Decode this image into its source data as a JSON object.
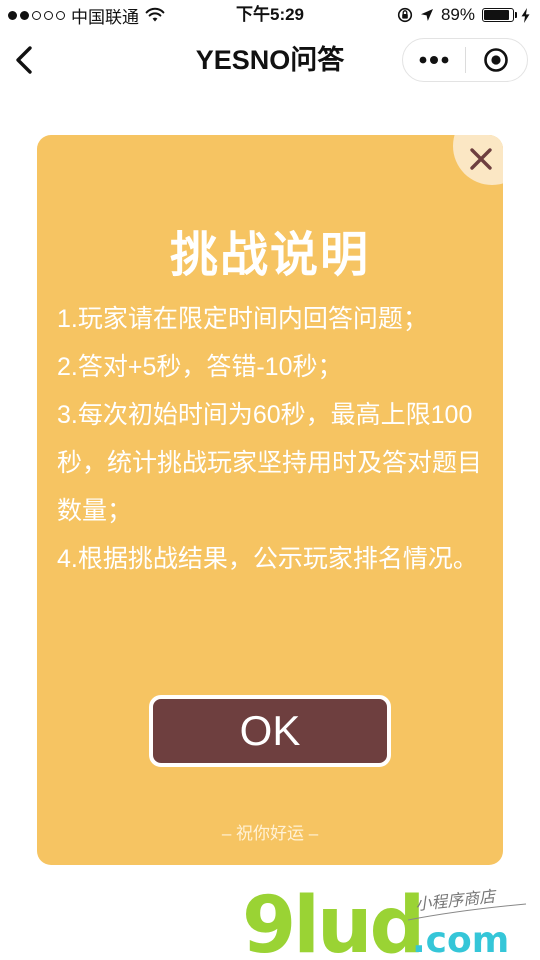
{
  "status_bar": {
    "carrier": "中国联通",
    "time": "下午5:29",
    "battery_percent": "89%",
    "battery_level": 0.89,
    "signal_bars_filled": 2,
    "signal_bars_total": 5,
    "icons": [
      "signal-dots-icon",
      "wifi-icon",
      "orientation-lock-icon",
      "location-arrow-icon",
      "battery-icon",
      "charging-bolt-icon"
    ]
  },
  "nav": {
    "title": "YESNO问答",
    "back_icon": "chevron-left-icon",
    "more_icon": "more-dots-icon",
    "close_icon": "target-circle-icon"
  },
  "modal": {
    "title": "挑战说明",
    "rules": [
      "1.玩家请在限定时间内回答问题；",
      "2.答对+5秒，答错-10秒；",
      "3.每次初始时间为60秒，最高上限100秒，统计挑战玩家坚持用时及答对题目数量；",
      "4.根据挑战结果，公示玩家排名情况。"
    ],
    "ok_label": "OK",
    "footer_text": "– 祝你好运 –",
    "close_icon": "close-x-icon"
  },
  "watermark": {
    "brand": "9lud",
    "domain": ".com",
    "tagline": "小程序商店"
  },
  "colors": {
    "modal_bg": "#f6c462",
    "ok_button_bg": "#6e3f3f",
    "close_corner_bg": "#fbe7c4",
    "watermark_green": "#9ad334",
    "watermark_cyan": "#35c6d8"
  }
}
